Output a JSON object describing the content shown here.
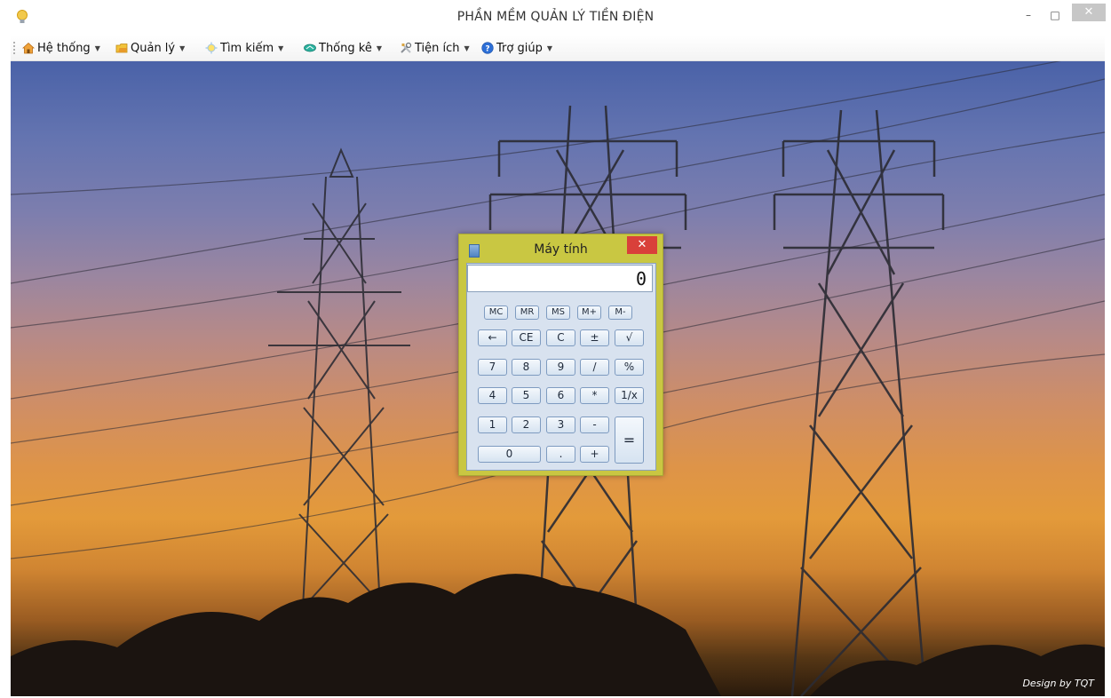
{
  "window": {
    "title": "PHẦN MỀM QUẢN LÝ TIỀN ĐIỆN",
    "minimize": "–",
    "maximize": "□",
    "close": "✕"
  },
  "menu": {
    "items": [
      {
        "label": "Hệ thống",
        "icon": "home-icon"
      },
      {
        "label": "Quản lý",
        "icon": "folder-icon"
      },
      {
        "label": "Tìm kiếm",
        "icon": "search-icon"
      },
      {
        "label": "Thống kê",
        "icon": "chart-icon"
      },
      {
        "label": "Tiện ích",
        "icon": "tools-icon"
      },
      {
        "label": "Trợ giúp",
        "icon": "help-icon"
      }
    ]
  },
  "background": {
    "subject": "power transmission towers at sunset",
    "credit": "Design by TQT"
  },
  "calculator": {
    "title": "Máy tính",
    "close": "✕",
    "display": "0",
    "memory_keys": [
      "MC",
      "MR",
      "MS",
      "M+",
      "M-"
    ],
    "row1": [
      "←",
      "CE",
      "C",
      "±",
      "√"
    ],
    "row2": [
      "7",
      "8",
      "9",
      "/",
      "%"
    ],
    "row3": [
      "4",
      "5",
      "6",
      "*",
      "1/x"
    ],
    "row4": [
      "1",
      "2",
      "3",
      "-"
    ],
    "row5": [
      "0",
      ".",
      "+"
    ],
    "equals": "="
  },
  "colors": {
    "calc_frame": "#c9c742",
    "calc_close": "#d9403a",
    "sky_top": "#4a62a8",
    "sky_bottom": "#e39a3a"
  }
}
